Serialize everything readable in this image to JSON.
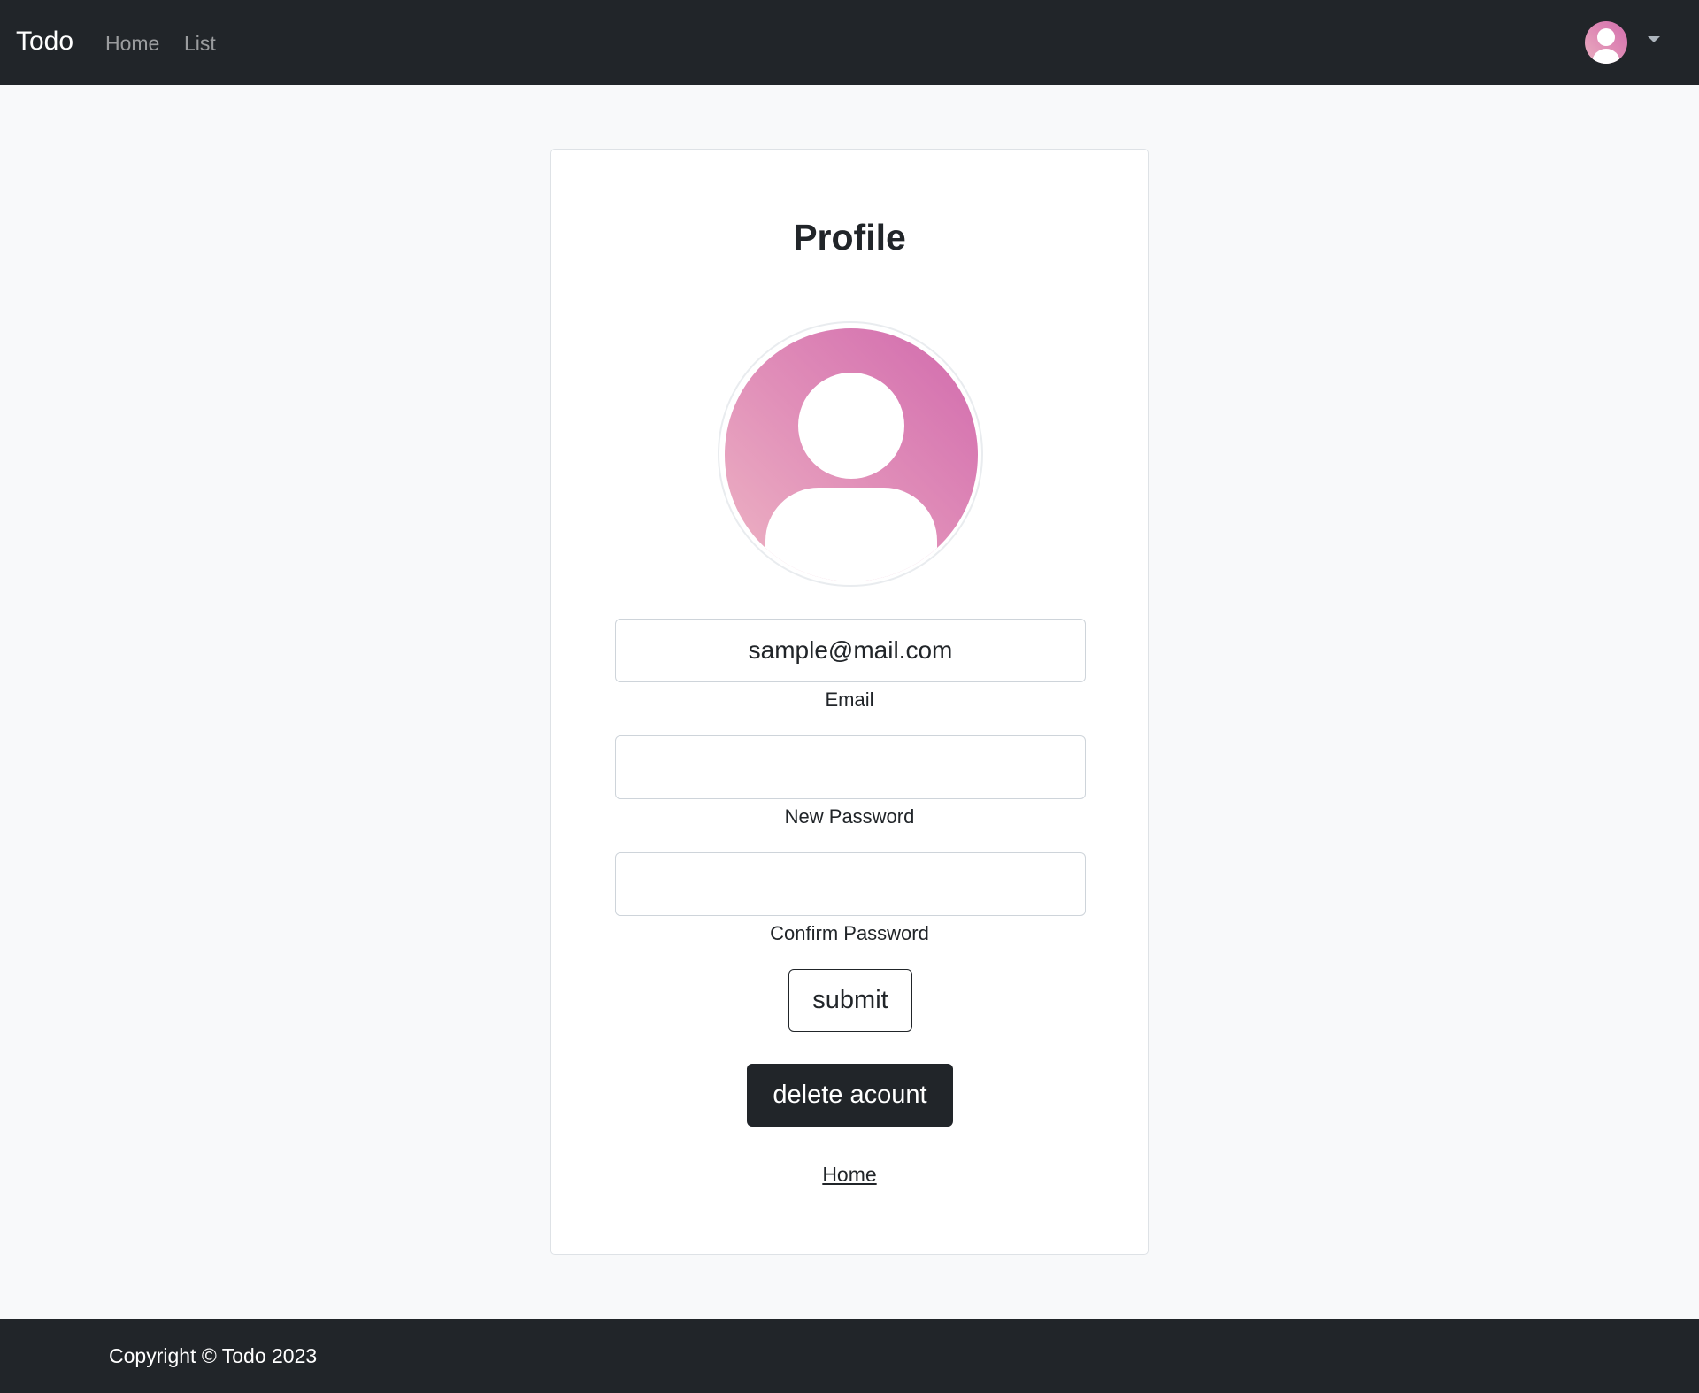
{
  "navbar": {
    "brand": "Todo",
    "links": [
      {
        "label": "Home"
      },
      {
        "label": "List"
      }
    ],
    "user_avatar_icon": "user-avatar-icon",
    "dropdown_icon": "caret-down-icon"
  },
  "profile": {
    "title": "Profile",
    "avatar_icon": "user-silhouette-icon",
    "add_photo_label": "+",
    "email": {
      "value": "sample@mail.com",
      "label": "Email"
    },
    "new_password": {
      "value": "",
      "label": "New Password"
    },
    "confirm_password": {
      "value": "",
      "label": "Confirm Password"
    },
    "submit_label": "submit",
    "delete_label": "delete acount",
    "home_link": "Home"
  },
  "footer": {
    "copyright": "Copyright © Todo 2023"
  },
  "colors": {
    "dark": "#212529",
    "background": "#f8f9fa",
    "avatar_gradient_start": "#eeb5c4",
    "avatar_gradient_end": "#d16aad"
  }
}
